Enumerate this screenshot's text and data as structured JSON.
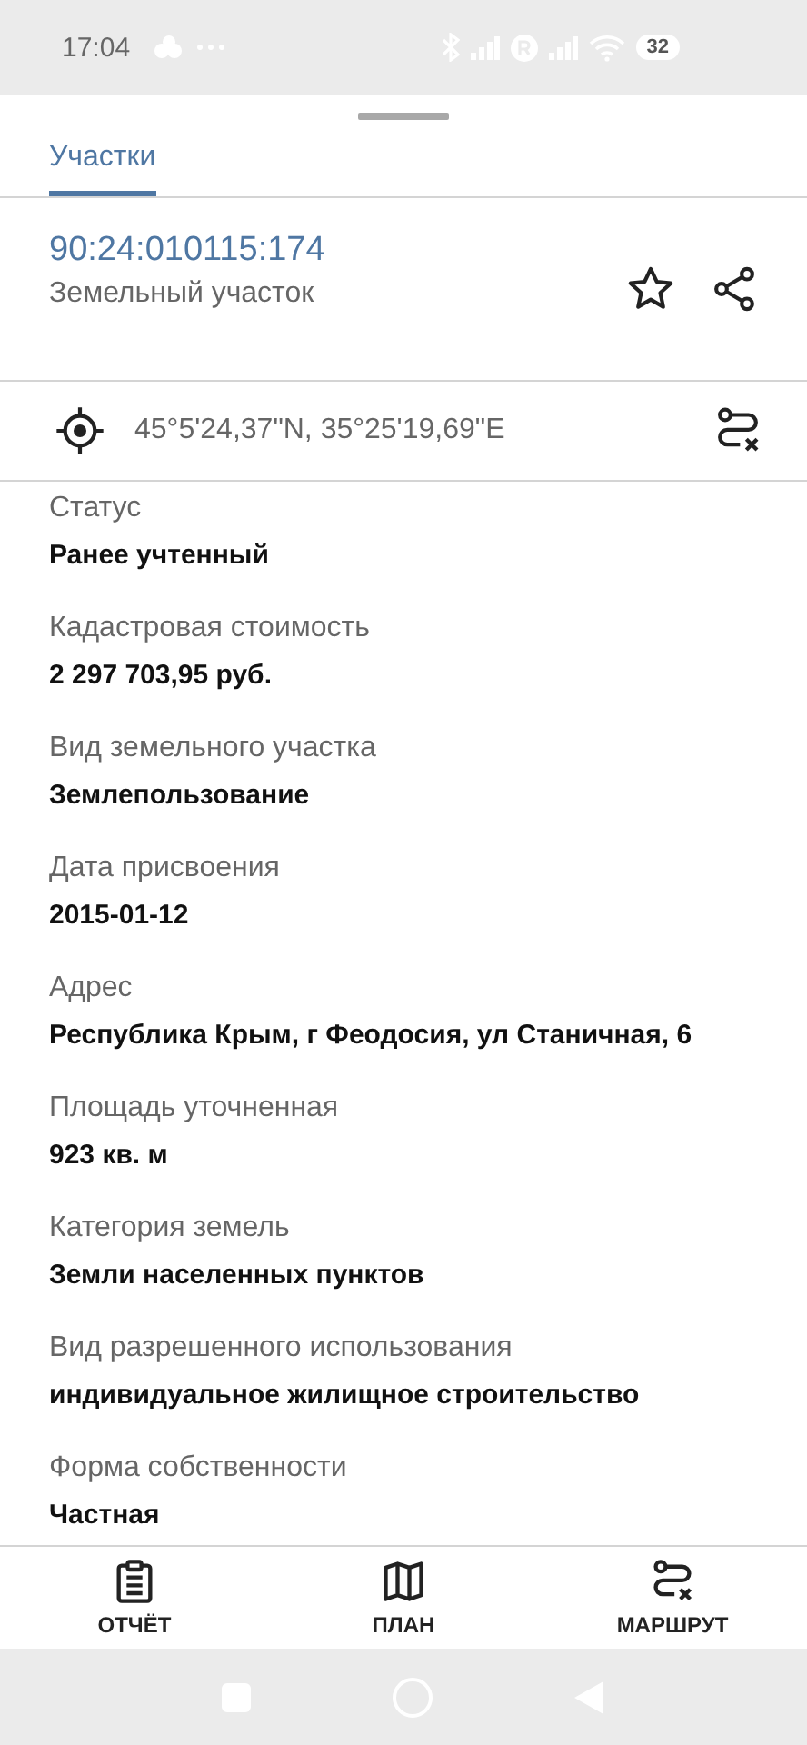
{
  "status_bar": {
    "time": "17:04",
    "battery": "32"
  },
  "tabs": [
    {
      "label": "Участки",
      "selected": true
    }
  ],
  "object": {
    "cadastral_number": "90:24:010115:174",
    "type": "Земельный участок",
    "favorite": false
  },
  "coordinates": "45°5'24,37\"N, 35°25'19,69\"E",
  "fields": [
    {
      "label": "Статус",
      "value": "Ранее учтенный"
    },
    {
      "label": "Кадастровая стоимость",
      "value": "2 297 703,95 руб."
    },
    {
      "label": "Вид земельного участка",
      "value": "Землепользование"
    },
    {
      "label": "Дата присвоения",
      "value": "2015-01-12"
    },
    {
      "label": "Адрес",
      "value": "Республика Крым, г Феодосия, ул Станичная, 6"
    },
    {
      "label": "Площадь уточненная",
      "value": "923 кв. м"
    },
    {
      "label": "Категория земель",
      "value": "Земли населенных пунктов"
    },
    {
      "label": "Вид разрешенного использования",
      "value": "индивидуальное жилищное строительство"
    },
    {
      "label": "Форма собственности",
      "value": "Частная"
    }
  ],
  "bottom_nav": [
    {
      "label": "ОТЧЁТ",
      "kind": "report"
    },
    {
      "label": "ПЛАН",
      "kind": "plan"
    },
    {
      "label": "МАРШРУТ",
      "kind": "route"
    }
  ]
}
